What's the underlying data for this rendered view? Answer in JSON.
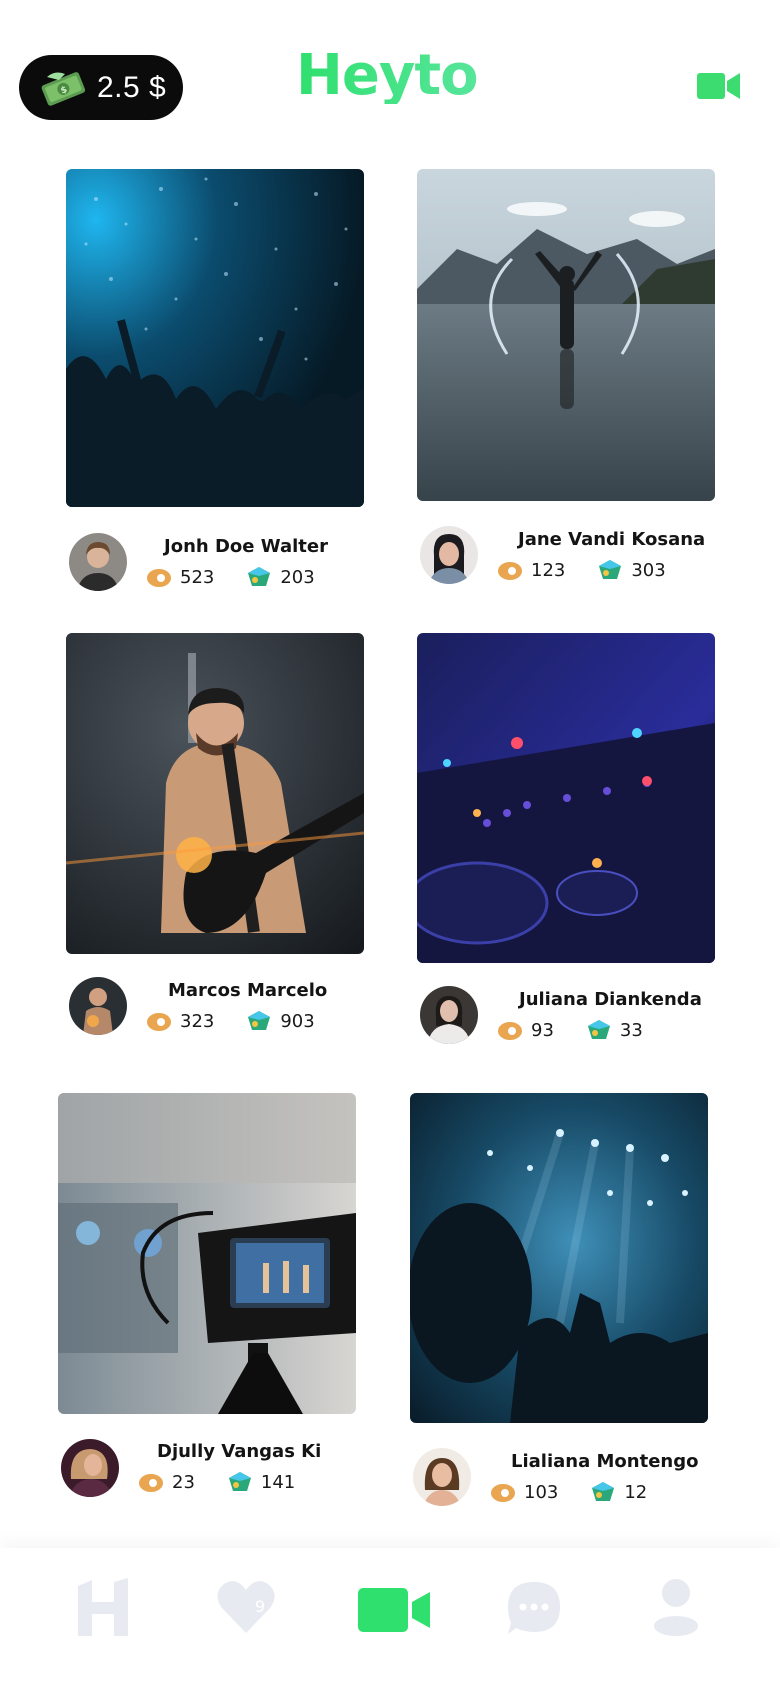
{
  "header": {
    "wallet_amount": "2.5 $",
    "logo_text": "Heyto",
    "wallet_icon": "money-bill-icon",
    "right_icon": "video-camera-icon"
  },
  "colors": {
    "brand": "#3ddc70",
    "wallet_bg": "#0b0b0b",
    "views_icon": "#e9a54f",
    "gem_icon": "#2aa87a",
    "nav_inactive": "#e8eaf2",
    "nav_active": "#2fe06e"
  },
  "cards": [
    {
      "name": "Jonh Doe Walter",
      "views": "523",
      "gems": "203",
      "scene": "concert-crowd-blue"
    },
    {
      "name": "Jane Vandi Kosana",
      "views": "123",
      "gems": "303",
      "scene": "woman-lake-splash"
    },
    {
      "name": "Marcos Marcelo",
      "views": "323",
      "gems": "903",
      "scene": "guitarist"
    },
    {
      "name": "Juliana Diankenda",
      "views": "93",
      "gems": "33",
      "scene": "dj-mixer"
    },
    {
      "name": "Djully Vangas Ki",
      "views": "23",
      "gems": "141",
      "scene": "video-camera-stage"
    },
    {
      "name": "Lialiana Montengo",
      "views": "103",
      "gems": "12",
      "scene": "concert-stage-lights"
    }
  ],
  "nav": {
    "items": [
      {
        "icon": "home-h-icon",
        "active": false
      },
      {
        "icon": "heart-icon",
        "active": false,
        "badge": "9"
      },
      {
        "icon": "video-camera-icon",
        "active": true
      },
      {
        "icon": "chat-bubble-icon",
        "active": false
      },
      {
        "icon": "profile-icon",
        "active": false
      }
    ]
  }
}
